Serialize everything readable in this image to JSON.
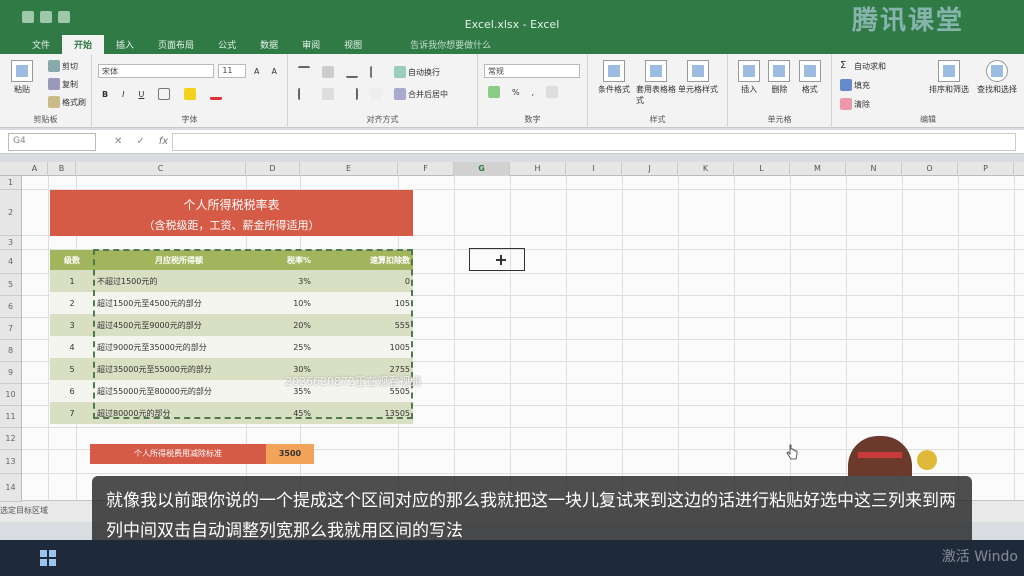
{
  "window": {
    "title": "Excel.xlsx - Excel",
    "brand": "腾讯课堂"
  },
  "tabs": [
    "文件",
    "开始",
    "插入",
    "页面布局",
    "公式",
    "数据",
    "审阅",
    "视图"
  ],
  "active_tab": "开始",
  "tell_me": "告诉我你想要做什么",
  "ribbon": {
    "clipboard": {
      "paste": "粘贴",
      "cut": "剪切",
      "copy": "复制",
      "format_painter": "格式刷",
      "label": "剪贴板"
    },
    "font": {
      "name": "宋体",
      "size": "11",
      "label": "字体"
    },
    "alignment": {
      "wrap": "自动换行",
      "merge": "合并后居中",
      "label": "对齐方式"
    },
    "number": {
      "format": "常规",
      "label": "数字"
    },
    "styles": {
      "conditional": "条件格式",
      "table": "套用表格格式",
      "cell": "单元格样式",
      "label": "样式"
    },
    "cells": {
      "insert": "插入",
      "delete": "删除",
      "format": "格式",
      "label": "单元格"
    },
    "editing": {
      "autosum": "自动求和",
      "fill": "填充",
      "clear": "清除",
      "sort": "排序和筛选",
      "find": "查找和选择",
      "label": "编辑"
    }
  },
  "formula_bar": {
    "name_box": "G4",
    "fx": "fx"
  },
  "columns": [
    "A",
    "B",
    "C",
    "D",
    "E",
    "F",
    "G",
    "H",
    "I",
    "J",
    "K",
    "L",
    "M",
    "N",
    "O",
    "P"
  ],
  "selected_column": "G",
  "rows": [
    "1",
    "2",
    "3",
    "4",
    "5",
    "6",
    "7",
    "8",
    "9",
    "10",
    "11",
    "12",
    "13",
    "14"
  ],
  "sheet": {
    "title_line1": "个人所得税税率表",
    "title_line2": "（含税级距，工资、薪金所得适用）",
    "headers": [
      "级数",
      "月应税所得额",
      "税率%",
      "速算扣除数"
    ],
    "rows": [
      {
        "level": "1",
        "range": "不超过1500元的",
        "rate": "3%",
        "deduction": "0"
      },
      {
        "level": "2",
        "range": "超过1500元至4500元的部分",
        "rate": "10%",
        "deduction": "105"
      },
      {
        "level": "3",
        "range": "超过4500元至9000元的部分",
        "rate": "20%",
        "deduction": "555"
      },
      {
        "level": "4",
        "range": "超过9000元至35000元的部分",
        "rate": "25%",
        "deduction": "1005"
      },
      {
        "level": "5",
        "range": "超过35000元至55000元的部分",
        "rate": "30%",
        "deduction": "2755"
      },
      {
        "level": "6",
        "range": "超过55000元至80000元的部分",
        "rate": "35%",
        "deduction": "5505"
      },
      {
        "level": "7",
        "range": "超过80000元的部分",
        "rate": "45%",
        "deduction": "13505"
      }
    ],
    "deduction_label": "个人所得税费用减除标准",
    "deduction_value": "3500"
  },
  "watermark": "2026620872正在观看视频",
  "status": {
    "ready": "选定目标区域"
  },
  "subtitle": "就像我以前跟你说的一个提成这个区间对应的那么我就把这一块儿复试来到这边的话进行粘贴好选中这三列来到两列中间双击自动调整列宽那么我就用区间的写法",
  "taskbar": {
    "activate": "激活 Windo"
  }
}
